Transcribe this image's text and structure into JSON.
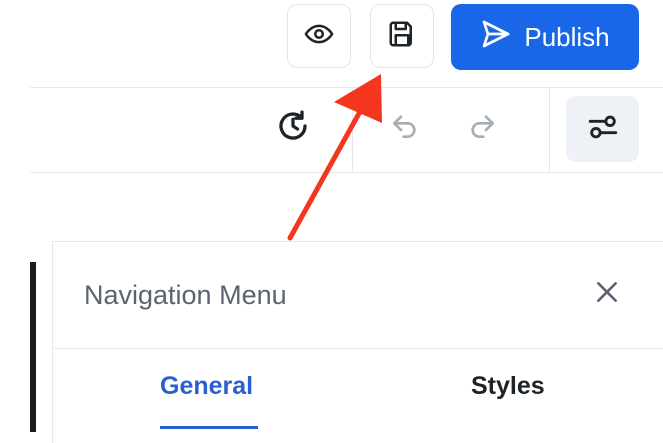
{
  "toolbar": {
    "preview_icon": "eye-icon",
    "save_icon": "floppy-disk-icon",
    "publish_label": "Publish",
    "publish_icon": "paper-plane-icon",
    "accent_color": "#1a66e8"
  },
  "editor_bar": {
    "history_icon": "clock-history-icon",
    "undo_icon": "undo-icon",
    "redo_icon": "redo-icon",
    "settings_icon": "settings-sliders-icon"
  },
  "annotation": {
    "arrow_color": "#f5361f",
    "arrow_points_to": "save-button"
  },
  "panel": {
    "title": "Navigation Menu",
    "close_icon": "close-icon",
    "tabs": [
      {
        "label": "General",
        "active": true
      },
      {
        "label": "Styles",
        "active": false
      }
    ]
  }
}
